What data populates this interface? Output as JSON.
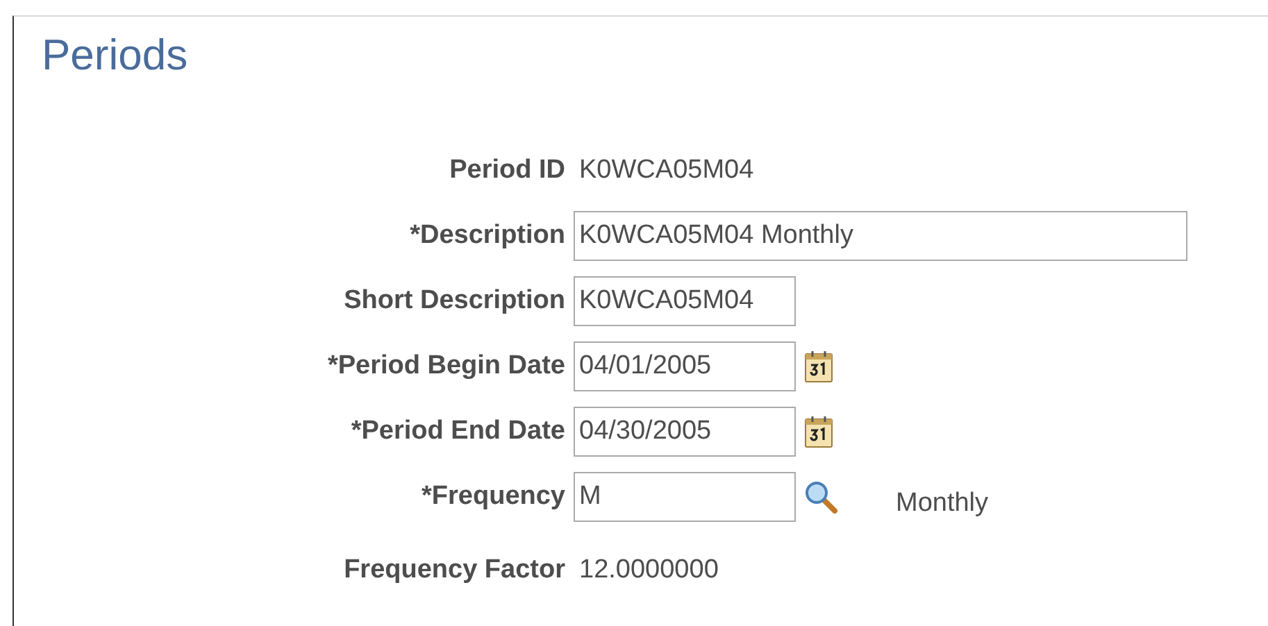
{
  "title": "Periods",
  "fields": [
    {
      "kind": "display",
      "label": "Period ID",
      "value": "K0WCA05M04"
    },
    {
      "kind": "text",
      "label": "*Description",
      "value": "K0WCA05M04 Monthly"
    },
    {
      "kind": "short",
      "label": "Short Description",
      "value": "K0WCA05M04"
    },
    {
      "kind": "date",
      "label": "*Period Begin Date",
      "value": "04/01/2005"
    },
    {
      "kind": "date",
      "label": "*Period End Date",
      "value": "04/30/2005"
    },
    {
      "kind": "lookup",
      "label": "*Frequency",
      "value": "M",
      "suffix": "Monthly"
    },
    {
      "kind": "display",
      "label": "Frequency Factor",
      "value": "12.0000000"
    }
  ]
}
